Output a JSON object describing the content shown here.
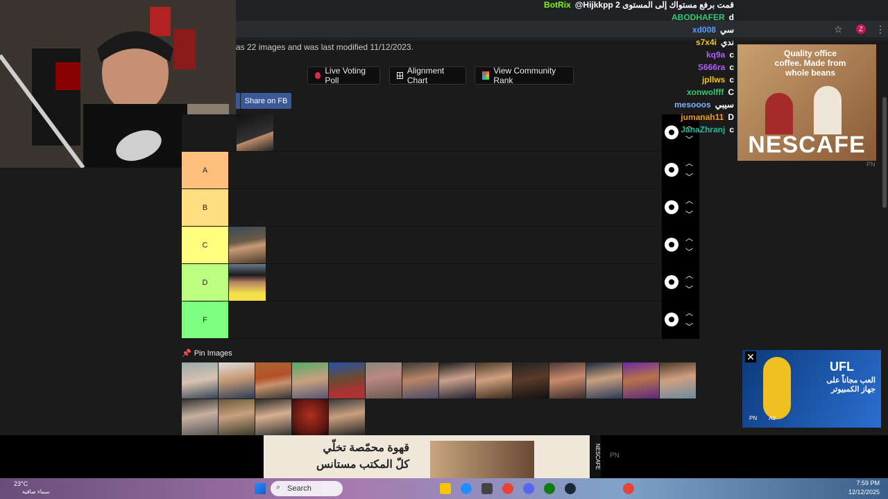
{
  "page": {
    "description": "as 22 images and was last modified 11/12/2023.",
    "buttons": {
      "voting": "Live Voting Poll",
      "alignment": "Alignment Chart",
      "community": "View Community Rank",
      "share_fb": "Share on FB"
    },
    "tiers": [
      {
        "label": "",
        "color": "#1a1a1a"
      },
      {
        "label": "A",
        "color": "#ffbf7f"
      },
      {
        "label": "B",
        "color": "#ffdf7f"
      },
      {
        "label": "C",
        "color": "#ffff7f"
      },
      {
        "label": "D",
        "color": "#bfff7f"
      },
      {
        "label": "F",
        "color": "#7fff7f"
      }
    ],
    "pin_label": "Pin Images"
  },
  "chat": [
    {
      "name": "BotRix",
      "name_color": "#7cfc00",
      "msg": "@Hijkkpp 2 قمت برفع مستواك إلى المستوى"
    },
    {
      "name": "ABODHAFER",
      "name_color": "#2ecc71",
      "msg": "d"
    },
    {
      "name": "xd008",
      "name_color": "#5a9bff",
      "msg": "سي"
    },
    {
      "name": "s7x4i",
      "name_color": "#f1c40f",
      "msg": "ندي"
    },
    {
      "name": "kq9a",
      "name_color": "#b05cff",
      "msg": "c"
    },
    {
      "name": "S666ra",
      "name_color": "#b05cff",
      "msg": "c"
    },
    {
      "name": "jpllws",
      "name_color": "#f1c40f",
      "msg": "c"
    },
    {
      "name": "xonwolfff",
      "name_color": "#2ecc71",
      "msg": "C"
    },
    {
      "name": "mesooos",
      "name_color": "#7fb3ff",
      "msg": "سيبي"
    },
    {
      "name": "jumanah11",
      "name_color": "#f39c12",
      "msg": "D"
    },
    {
      "name": "JanaZhranj",
      "name_color": "#1abc9c",
      "msg": "c"
    }
  ],
  "ads": {
    "right_text": "Quality office coffee. Made from whole beans",
    "right_brand": "NESCAFE",
    "right_mark": "PN",
    "video_brand": "UFL",
    "video_text": "العب مجاناً على جهاز الكمبيوتر",
    "video_ad": "Ad",
    "video_mark": "PN",
    "bottom_text_1": "قهوة محمّصة تخلّي",
    "bottom_text_2": "كلّ المكتب مستانس",
    "bottom_brand": "NESCAFE",
    "bottom_mark": "PN"
  },
  "taskbar": {
    "search": "Search",
    "temp": "23°C",
    "weather": "سماء صافية",
    "time": "7:59 PM",
    "date": "12/12/2025"
  },
  "browser": {
    "profile": "Z"
  }
}
